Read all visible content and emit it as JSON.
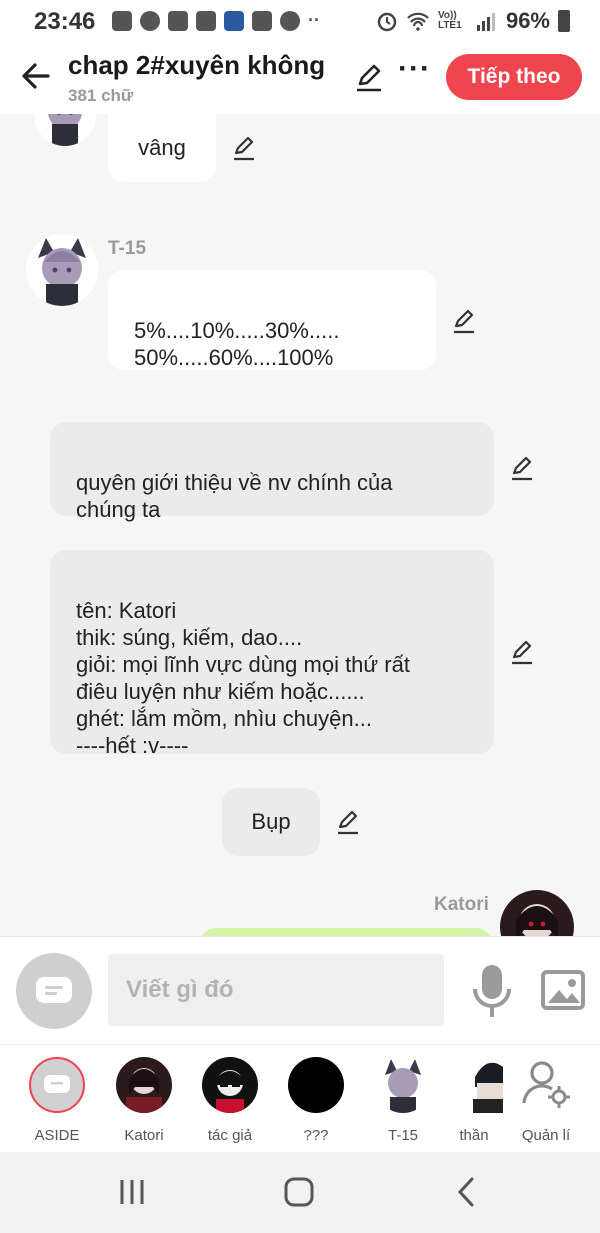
{
  "status_bar": {
    "time": "23:46",
    "network_label": "Vo)) LTE1",
    "battery": "96%"
  },
  "header": {
    "title": "chap 2#xuyên không",
    "subtitle": "381 chữ",
    "next_button": "Tiếp theo"
  },
  "messages": [
    {
      "type": "character",
      "text": "vâng"
    },
    {
      "type": "character",
      "speaker": "T-15",
      "text": "5%....10%.....30%.....\n50%.....60%....100%"
    },
    {
      "type": "narration",
      "text": "quyên giới thiệu về nv chính của\nchúng ta"
    },
    {
      "type": "narration",
      "text": "tên: Katori\nthik: súng, kiếm, dao....\ngiỏi: mọi lĩnh vực dùng mọi thứ rất\nđiêu luyện như kiếm hoặc......\nghét: lắm mồm, nhìu chuyện...\n----hết :v----"
    },
    {
      "type": "sound",
      "text": "Bụp"
    },
    {
      "type": "character-right",
      "speaker": "Katori",
      "text": ""
    }
  ],
  "composer": {
    "placeholder": "Viết gì đó"
  },
  "characters": [
    {
      "label": "ASIDE"
    },
    {
      "label": "Katori"
    },
    {
      "label": "tác giả"
    },
    {
      "label": "???"
    },
    {
      "label": "T-15"
    },
    {
      "label": "thần"
    },
    {
      "label": "Quản lí"
    }
  ],
  "colors": {
    "accent": "#f0444f",
    "bubble_narration": "#ebebeb",
    "bubble_right": "#d4f5a8"
  }
}
